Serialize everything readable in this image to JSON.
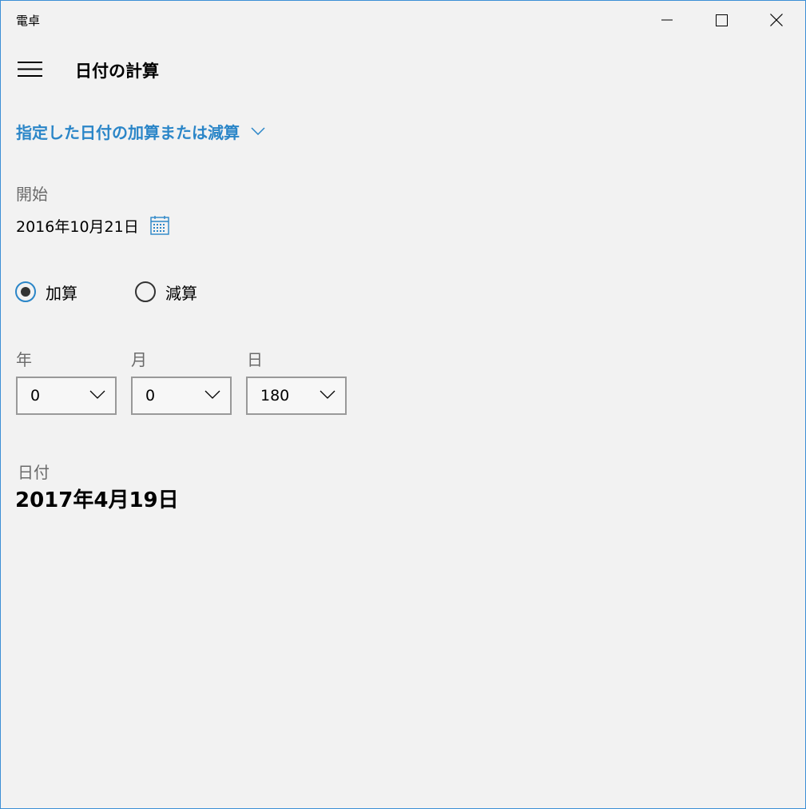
{
  "window": {
    "title": "電卓",
    "min_icon": "minimize-icon",
    "max_icon": "maximize-icon",
    "close_icon": "close-icon"
  },
  "header": {
    "menu_icon": "hamburger-menu-icon",
    "title": "日付の計算"
  },
  "mode": {
    "label": "指定した日付の加算または減算",
    "icon": "chevron-down-icon"
  },
  "start": {
    "label": "開始",
    "date": "2016年10月21日",
    "icon": "calendar-icon"
  },
  "operation": {
    "add_label": "加算",
    "subtract_label": "減算",
    "selected": "add"
  },
  "offset": {
    "year_label": "年",
    "year_value": "0",
    "month_label": "月",
    "month_value": "0",
    "day_label": "日",
    "day_value": "180"
  },
  "result": {
    "label": "日付",
    "date": "2017年4月19日"
  },
  "colors": {
    "accent": "#2b86c8",
    "background": "#f2f2f2",
    "window_border": "#3c8fd6"
  }
}
